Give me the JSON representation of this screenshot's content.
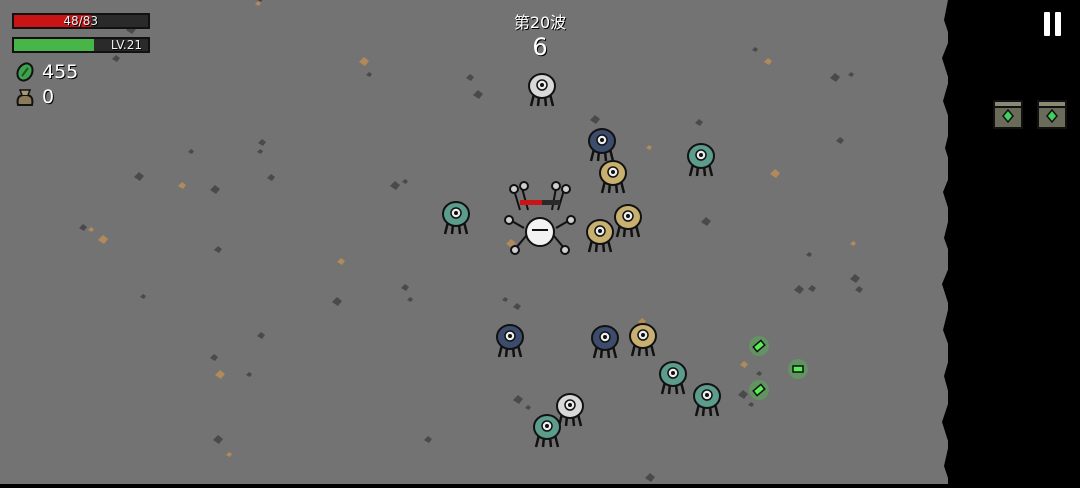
{
  "hud": {
    "hp": {
      "current": 48,
      "max": 83,
      "label": "48/83",
      "color": "#c81414"
    },
    "xp": {
      "label": "LV.21",
      "progress": 0.6,
      "color": "#47b547"
    },
    "materials": {
      "value": "455",
      "icon": "material-icon"
    },
    "bag": {
      "value": "0",
      "icon": "bag-icon"
    }
  },
  "wave": {
    "label": "第20波",
    "timer": "6"
  },
  "controls": {
    "pause": "pause-icon"
  },
  "inventory": {
    "items": [
      "consumable-crate",
      "consumable-crate"
    ]
  },
  "colors": {
    "arena": "#737373",
    "outside": "#000000",
    "enemy_shell": "#5c9c8c",
    "material": "#44cc44"
  }
}
